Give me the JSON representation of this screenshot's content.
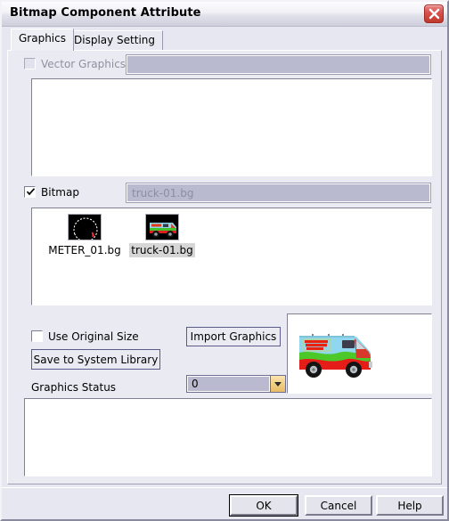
{
  "window": {
    "title": "Bitmap Component Attribute",
    "close_icon": "close-x-icon"
  },
  "tabs": [
    {
      "label": "Graphics",
      "active": true
    },
    {
      "label": "Display Setting",
      "active": false
    }
  ],
  "vector_section": {
    "checkbox_label": "Vector Graphics",
    "checked": false,
    "enabled": false,
    "field_value": ""
  },
  "bitmap_section": {
    "checkbox_label": "Bitmap",
    "checked": true,
    "enabled": true,
    "field_value": "truck-01.bg",
    "items": [
      {
        "label": "METER_01.bg",
        "selected": false,
        "icon": "gauge-thumbnail-icon"
      },
      {
        "label": "truck-01.bg",
        "selected": true,
        "icon": "van-thumbnail-icon"
      }
    ]
  },
  "controls": {
    "use_original_size_label": "Use Original Size",
    "use_original_size_checked": false,
    "save_to_library_label": "Save to System Library",
    "import_graphics_label": "Import Graphics",
    "graphics_status_label": "Graphics Status",
    "status_value": "0",
    "status_options": [
      "0"
    ],
    "dropdown_icon": "chevron-down-icon"
  },
  "preview": {
    "image_name": "mystery-machine-van-preview"
  },
  "footer": {
    "ok_label": "OK",
    "cancel_label": "Cancel",
    "help_label": "Help"
  },
  "colors": {
    "dialog_bg": "#e9eaf2",
    "titlebar_light": "#fdfdff",
    "close_red": "#c0392b",
    "field_disabled": "#b9bad0",
    "button_outline": "#5b5b8a",
    "combo_arrow": "#f3cf84",
    "selection_gray": "#d6d6d6"
  }
}
